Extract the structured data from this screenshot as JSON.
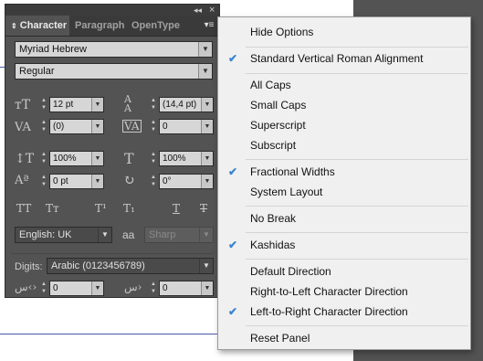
{
  "titlebar": {
    "collapse": "◂◂",
    "close": "×"
  },
  "tabs": [
    {
      "label": "Character",
      "active": true
    },
    {
      "label": "Paragraph",
      "active": false
    },
    {
      "label": "OpenType",
      "active": false
    }
  ],
  "font_family": "Myriad Hebrew",
  "font_style": "Regular",
  "font_size": "12 pt",
  "leading": "(14,4 pt)",
  "kerning": "(0)",
  "tracking": "0",
  "vertical_scale": "100%",
  "horizontal_scale": "100%",
  "baseline_shift": "0 pt",
  "character_rotation": "0°",
  "type_buttons": [
    "TT",
    "Tт",
    "T¹",
    "T₁",
    "T",
    "T"
  ],
  "language": "English: UK",
  "antialias_icon_text": "aa",
  "antialias": "Sharp",
  "digits_label": "Digits:",
  "digits": "Arabic (0123456789)",
  "kashida_before": "0",
  "kashida_after": "0",
  "menu": {
    "items": [
      {
        "label": "Hide Options",
        "checked": false
      },
      {
        "label": "Standard Vertical Roman Alignment",
        "checked": true
      },
      {
        "label": "All Caps",
        "checked": false
      },
      {
        "label": "Small Caps",
        "checked": false
      },
      {
        "label": "Superscript",
        "checked": false
      },
      {
        "label": "Subscript",
        "checked": false
      },
      {
        "label": "Fractional Widths",
        "checked": true
      },
      {
        "label": "System Layout",
        "checked": false
      },
      {
        "label": "No Break",
        "checked": false
      },
      {
        "label": "Kashidas",
        "checked": true
      },
      {
        "label": "Default Direction",
        "checked": false
      },
      {
        "label": "Right-to-Left Character Direction",
        "checked": false
      },
      {
        "label": "Left-to-Right Character Direction",
        "checked": true
      },
      {
        "label": "Reset Panel",
        "checked": false
      }
    ],
    "checkmark": "✔"
  },
  "colors": {
    "accent": "#3a83d1",
    "panel": "#535353",
    "menu": "#f0f0f0"
  }
}
